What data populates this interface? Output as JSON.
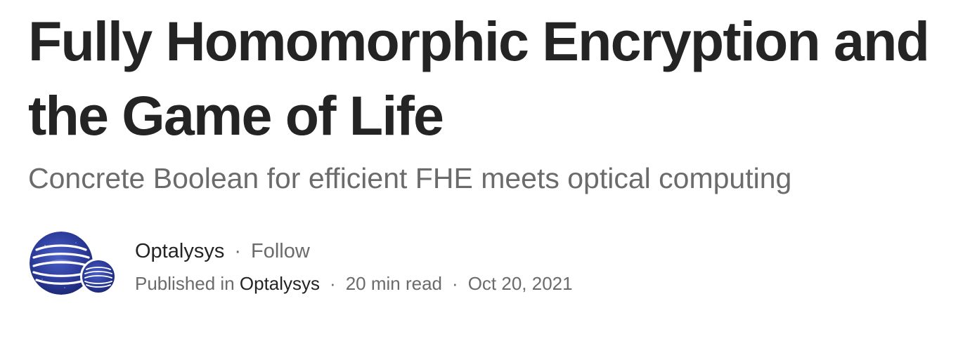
{
  "article": {
    "title": "Fully Homomorphic Encryption and the Game of Life",
    "subtitle": "Concrete Boolean for efficient FHE meets optical computing"
  },
  "byline": {
    "author_name": "Optalysys",
    "separator": "·",
    "follow_label": "Follow",
    "published_in_prefix": "Published in",
    "publication_name": "Optalysys",
    "read_time": "20 min read",
    "date": "Oct 20, 2021",
    "author_avatar_icon": "optalysys-logo-icon",
    "publication_avatar_icon": "optalysys-logo-icon"
  },
  "colors": {
    "title_text": "#242424",
    "secondary_text": "#6b6b6b",
    "avatar_dark_blue": "#1c2a82",
    "avatar_light_blue": "#3d52b8"
  }
}
